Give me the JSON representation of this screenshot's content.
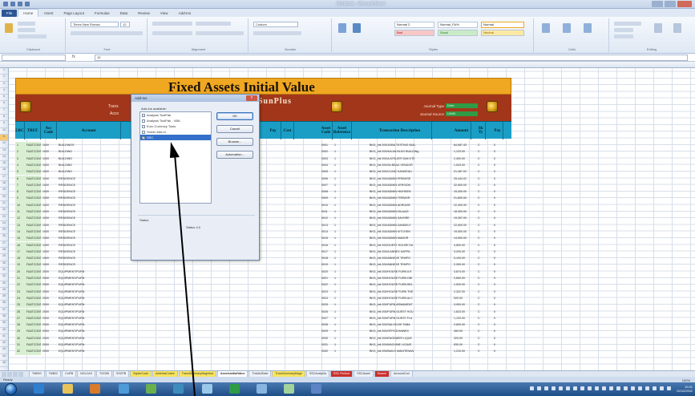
{
  "excel": {
    "window_title": "Workbook - Microsoft Excel",
    "ribbon_tabs": [
      "File",
      "Home",
      "Insert",
      "Page Layout",
      "Formulas",
      "Data",
      "Review",
      "View",
      "Add-Ins"
    ],
    "ribbon_groups": [
      "Clipboard",
      "Font",
      "Alignment",
      "Number",
      "Styles",
      "Cells",
      "Editing"
    ],
    "font_name": "Times New Roman",
    "font_size": "12",
    "number_format": "Custom",
    "styles": [
      "Normal 2",
      "Normal_FA%",
      "Normal",
      "Bad",
      "Good",
      "Neutral"
    ],
    "name_box": "",
    "formula": "12",
    "fx_label": "fx"
  },
  "report": {
    "title": "Fixed Assets Initial Value",
    "sunplus": "SunPlus",
    "left_label_1": "Trans",
    "left_label_2": "Acco",
    "journal_type_label": "Journal Type",
    "journal_type_value": "Dete",
    "journal_source_label": "Journal Source",
    "journal_source_value": "UWM",
    "headers": [
      "LRC",
      "TREF",
      "Acc Code",
      "Account",
      "Pay",
      "Cost",
      "Asset Code",
      "Asset Reference",
      "Transaction Description",
      "Amount",
      "Sh Ty",
      "Pay"
    ],
    "rows": [
      [
        "1",
        "FAATCONT",
        "1000",
        "BUILDINGS",
        "",
        "",
        "0001",
        "1",
        "BKG_Init 200/10/BA TESTING BUIL",
        "84,587.43",
        "C",
        "0"
      ],
      [
        "2",
        "FAATCONT",
        "1000",
        "BUILDING",
        "",
        "",
        "0002",
        "1",
        "BKG_Init 200/9/A AN BLDG BUILDINg",
        "1,123.00",
        "C",
        "0"
      ],
      [
        "3",
        "FAATCONT",
        "1000",
        "BUILDING",
        "",
        "",
        "0003",
        "1",
        "BKG_Init 200/A ATELIER SAN DTE",
        "2,400.00",
        "C",
        "0"
      ],
      [
        "4",
        "FAATCONT",
        "1000",
        "BUILDING",
        "",
        "",
        "0004",
        "1",
        "BKG_Init 200/9A BEAU VENDOR",
        "1,543.00",
        "C",
        "0"
      ],
      [
        "5",
        "FAATCONT",
        "1000",
        "BUILDING",
        "",
        "",
        "0005",
        "1",
        "BKG_Init 200/CLINIC KANGEAU",
        "21,467.02",
        "C",
        "0"
      ],
      [
        "6",
        "FAATCONT",
        "1000",
        "RESIDENCE",
        "",
        "",
        "0006",
        "1",
        "BKG_Init 200/ADMIN PREMISE",
        "25,444.02",
        "C",
        "0"
      ],
      [
        "7",
        "FAATCONT",
        "1000",
        "RESIDENCE",
        "",
        "",
        "0007",
        "1",
        "BKG_Init 200/ADMIN VERSION",
        "32,600.00",
        "C",
        "0"
      ],
      [
        "8",
        "FAATCONT",
        "1000",
        "RESIDENCE",
        "",
        "",
        "0008",
        "1",
        "BKG_Init 200/ADMIN HIGHDEN",
        "15,300.00",
        "C",
        "0"
      ],
      [
        "9",
        "FAATCONT",
        "1000",
        "RESIDENCE",
        "",
        "",
        "0009",
        "1",
        "BKG_Init 200/ADMIN TREMOR",
        "21,800.00",
        "C",
        "0"
      ],
      [
        "10",
        "FAATCONT",
        "1000",
        "RESIDENCE",
        "",
        "",
        "0010",
        "1",
        "BKG_Init 200/ADMIN ADRIAGE",
        "22,400.00",
        "C",
        "0"
      ],
      [
        "11",
        "FAATCONT",
        "1000",
        "RESIDENCE",
        "",
        "",
        "0011",
        "1",
        "BKG_Init 200/ADMIN DILAAZI",
        "18,300.00",
        "C",
        "0"
      ],
      [
        "12",
        "FAATCONT",
        "1000",
        "RESIDENCE",
        "",
        "",
        "0012",
        "1",
        "BKG_Init 200/ADMIN SAVORE",
        "19,357.00",
        "C",
        "0"
      ],
      [
        "13",
        "FAATCONT",
        "1000",
        "RESIDENCE",
        "",
        "",
        "0013",
        "1",
        "BKG_Init 200/ADMIN DANDELY",
        "22,500.00",
        "C",
        "0"
      ],
      [
        "14",
        "FAATCONT",
        "1000",
        "RESIDENCE",
        "",
        "",
        "0014",
        "1",
        "BKG_Init 200/ADMIN KITCHEN",
        "19,500.00",
        "C",
        "0"
      ],
      [
        "15",
        "FAATCONT",
        "1000",
        "RESIDENCE",
        "",
        "",
        "0015",
        "1",
        "BKG_Init 200/ADMIN MANOR",
        "14,500.00",
        "C",
        "0"
      ],
      [
        "16",
        "FAATCONT",
        "1000",
        "RESIDENCE",
        "",
        "",
        "0016",
        "1",
        "BKG_Init 200/GUEST HOUSE KA",
        "4,600.00",
        "C",
        "0"
      ],
      [
        "17",
        "FAATCONT",
        "1000",
        "RESIDENCE",
        "",
        "",
        "0017",
        "1",
        "BKG_Init 200/A ANNEX KAPPA",
        "3,200.00",
        "C",
        "0"
      ],
      [
        "18",
        "FAATCONT",
        "1000",
        "RESIDENCE",
        "",
        "",
        "0018",
        "1",
        "BKG_Init 200/ANNEXE TEMPO",
        "3,100.00",
        "C",
        "0"
      ],
      [
        "19",
        "FAATCONT",
        "1000",
        "RESIDENCE",
        "",
        "",
        "0019",
        "1",
        "BKG_Init 200/ANNEXE TEMPO",
        "2,050.00",
        "C",
        "0"
      ],
      [
        "20",
        "FAATCONT",
        "2000",
        "EQUIPMENT/FURN",
        "",
        "",
        "0020",
        "1",
        "BKG_Init 200/HOUSE FURN A E",
        "3,874.00",
        "C",
        "0"
      ],
      [
        "21",
        "FAATCONT",
        "2000",
        "EQUIPMENT/FURN",
        "",
        "",
        "0021",
        "1",
        "BKG_Init 200/HOUSE FURN DBI",
        "2,650.00",
        "C",
        "0"
      ],
      [
        "22",
        "FAATCONT",
        "2000",
        "EQUIPMENT/FURN",
        "",
        "",
        "0022",
        "1",
        "BKG_Init 200/HOUSE FURN BEL",
        "1,520.00",
        "C",
        "0"
      ],
      [
        "23",
        "FAATCONT",
        "2000",
        "EQUIPMENT/FURN",
        "",
        "",
        "0023",
        "1",
        "BKG_Init 200/HOUSE FURN THE",
        "2,322.00",
        "C",
        "0"
      ],
      [
        "24",
        "FAATCONT",
        "2000",
        "EQUIPMENT/FURN",
        "",
        "",
        "0024",
        "1",
        "BKG_Init 200/HOUSE FURN ALC",
        "920.00",
        "C",
        "0"
      ],
      [
        "25",
        "FAATCONT",
        "2000",
        "EQUIPMENT/FURN",
        "",
        "",
        "0025",
        "1",
        "BKG_Init 200/FURN ARMAMENT",
        "3,900.00",
        "C",
        "0"
      ],
      [
        "26",
        "FAATCONT",
        "2000",
        "EQUIPMENT/FURN",
        "",
        "",
        "0026",
        "1",
        "BKG_Init 200/FURN GUEST HOU",
        "1,823.00",
        "C",
        "0"
      ],
      [
        "27",
        "FAATCONT",
        "2000",
        "EQUIPMENT/FURN",
        "",
        "",
        "0027",
        "1",
        "BKG_Init 200/FURN GUEST FLA",
        "1,120.00",
        "C",
        "0"
      ],
      [
        "28",
        "FAATCONT",
        "2000",
        "EQUIPMENT/FURN",
        "",
        "",
        "0028",
        "1",
        "BKG_Init 200/SALON DE TABA",
        "2,600.00",
        "C",
        "0"
      ],
      [
        "29",
        "FAATCONT",
        "2000",
        "EQUIPMENT/FURN",
        "",
        "",
        "0029",
        "1",
        "BKG_Init 200/OFFICE/ANNEX",
        "450.00",
        "C",
        "0"
      ],
      [
        "30",
        "FAATCONT",
        "2000",
        "EQUIPMENT/FURN",
        "",
        "",
        "0030",
        "1",
        "BKG_Init 200/ENGINEER LIQUE",
        "320.00",
        "C",
        "0"
      ],
      [
        "31",
        "FAATCONT",
        "2000",
        "EQUIPMENT/FURN",
        "",
        "",
        "0031",
        "1",
        "BKG_Init 200/MACHINE LICAVE",
        "530.00",
        "C",
        "0"
      ],
      [
        "32",
        "FAATCONT",
        "2000",
        "EQUIPMENT/FURN",
        "",
        "",
        "0032",
        "1",
        "BKG_Init 200/BUILD MAINTENAN",
        "1,210.00",
        "C",
        "0"
      ]
    ]
  },
  "dialog": {
    "title": "Add-Ins",
    "available_label": "Add-Ins available:",
    "items": [
      {
        "label": "Analysis ToolPak",
        "checked": false
      },
      {
        "label": "Analysis ToolPak - VBA",
        "checked": false
      },
      {
        "label": "Euro Currency Tools",
        "checked": false
      },
      {
        "label": "Solver Add-in",
        "checked": false
      },
      {
        "label": "SSC",
        "checked": true
      }
    ],
    "selected_index": 4,
    "buttons": [
      "OK",
      "Cancel",
      "Browse...",
      "Automation..."
    ],
    "info_label": "Status",
    "info_text": "Status 4.0"
  },
  "sheet_tabs": [
    "TMB20",
    "TMB22",
    "ColFB",
    "NOLCAS",
    "TGCB5",
    "SSCPB",
    "SaplerCode",
    "AddressCodes",
    "TransSummaryMagnitud",
    "AssetsInitialValue",
    "TmbActDate",
    "TransSummaryMagn",
    "SSCAnalyNa",
    "SSC FinAcct",
    "SSCAsset",
    "Source",
    "AccountCod"
  ],
  "active_sheet": "AssetsInitialValue",
  "status": {
    "left": "Ready",
    "zoom": "100%"
  },
  "taskbar": {
    "time": "10:41",
    "date": "02/12/2011"
  }
}
